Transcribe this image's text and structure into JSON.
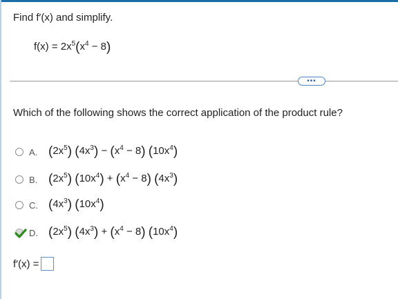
{
  "question": {
    "title": "Find f′(x) and simplify.",
    "function_lhs": "f(x) = 2x",
    "function_exp": "5",
    "function_inner": "x",
    "function_inner_exp": "4",
    "function_inner_rest": " − 8",
    "more_label": "•••",
    "prompt": "Which of the following shows the correct application of the product rule?"
  },
  "options": [
    {
      "letter": "A.",
      "selected": false,
      "terms": [
        [
          "2x",
          "5"
        ],
        [
          "4x",
          "3"
        ]
      ],
      "op": "−",
      "terms2": [
        [
          "x",
          "4",
          " − 8"
        ],
        [
          "10x",
          "4"
        ]
      ]
    },
    {
      "letter": "B.",
      "selected": false,
      "terms": [
        [
          "2x",
          "5"
        ],
        [
          "10x",
          "4"
        ]
      ],
      "op": "+",
      "terms2": [
        [
          "x",
          "4",
          " − 8"
        ],
        [
          "4x",
          "3"
        ]
      ]
    },
    {
      "letter": "C.",
      "selected": false,
      "terms": [
        [
          "4x",
          "3"
        ],
        [
          "10x",
          "4"
        ]
      ]
    },
    {
      "letter": "D.",
      "selected": true,
      "terms": [
        [
          "2x",
          "5"
        ],
        [
          "4x",
          "3"
        ]
      ],
      "op": "+",
      "terms2": [
        [
          "x",
          "4",
          " − 8"
        ],
        [
          "10x",
          "4"
        ]
      ]
    }
  ],
  "answer": {
    "label": "f′(x) =",
    "value": ""
  },
  "colors": {
    "accent": "#1a6fa8",
    "check": "#2e8b1e"
  }
}
